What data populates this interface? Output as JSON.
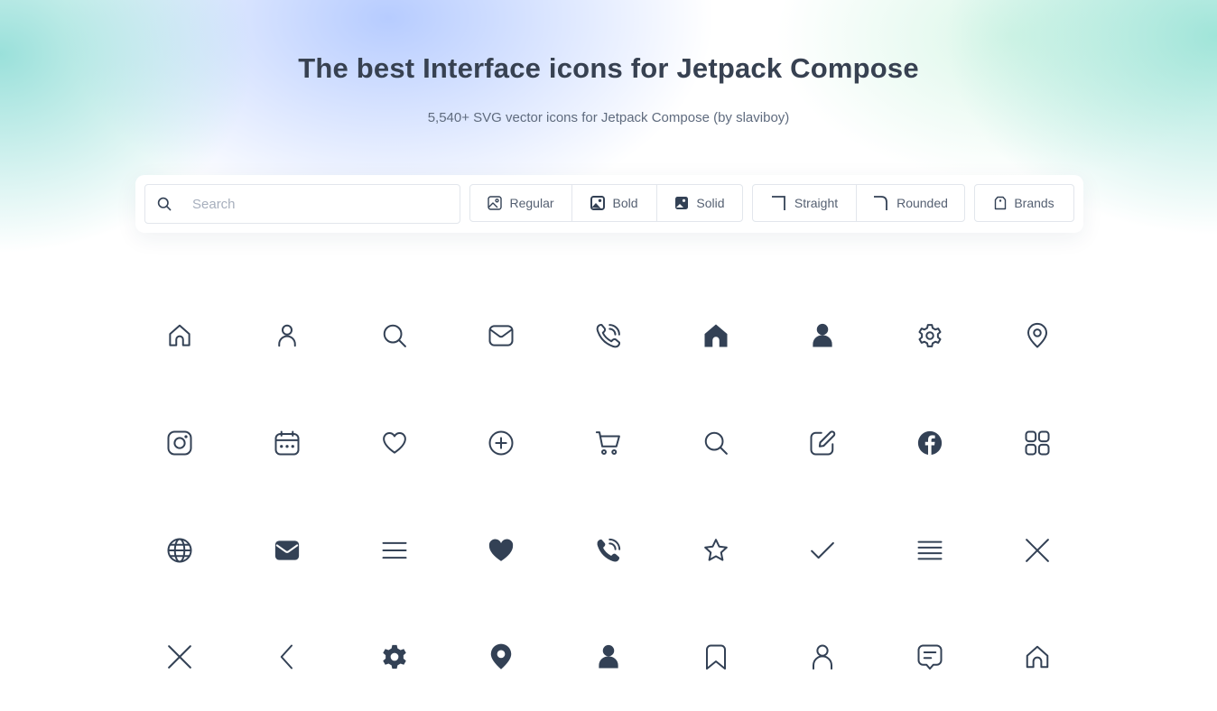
{
  "header": {
    "title": "The best Interface icons for Jetpack Compose",
    "subtitle": "5,540+ SVG vector icons for Jetpack Compose (by slaviboy)"
  },
  "search": {
    "placeholder": "Search",
    "value": ""
  },
  "style_filters": [
    {
      "label": "Regular",
      "icon": "image-outline-icon"
    },
    {
      "label": "Bold",
      "icon": "image-bold-icon"
    },
    {
      "label": "Solid",
      "icon": "image-solid-icon"
    }
  ],
  "corner_filters": [
    {
      "label": "Straight",
      "icon": "corner-straight-icon"
    },
    {
      "label": "Rounded",
      "icon": "corner-rounded-icon"
    }
  ],
  "brands_filter": {
    "label": "Brands",
    "icon": "tag-icon"
  },
  "colors": {
    "icon": "#334155",
    "title": "#374151",
    "subtitle": "#5f6b7e",
    "border": "#e2e6ec"
  },
  "icons": [
    "home-icon",
    "user-icon",
    "search-icon",
    "mail-icon",
    "phone-call-icon",
    "home-solid-icon",
    "user-solid-icon",
    "settings-icon",
    "location-pin-icon",
    "instagram-icon",
    "calendar-icon",
    "heart-icon",
    "add-circle-icon",
    "cart-icon",
    "search-bold-icon",
    "edit-icon",
    "facebook-icon",
    "apps-grid-icon",
    "globe-icon",
    "mail-solid-icon",
    "menu-icon",
    "heart-solid-icon",
    "phone-call-solid-icon",
    "star-icon",
    "check-icon",
    "text-align-justify-icon",
    "close-icon",
    "close-bold-icon",
    "chevron-left-icon",
    "settings-solid-icon",
    "location-pin-solid-icon",
    "user-solid-small-icon",
    "bookmark-icon",
    "user-thin-icon",
    "comment-text-icon",
    "home-alt-icon"
  ]
}
